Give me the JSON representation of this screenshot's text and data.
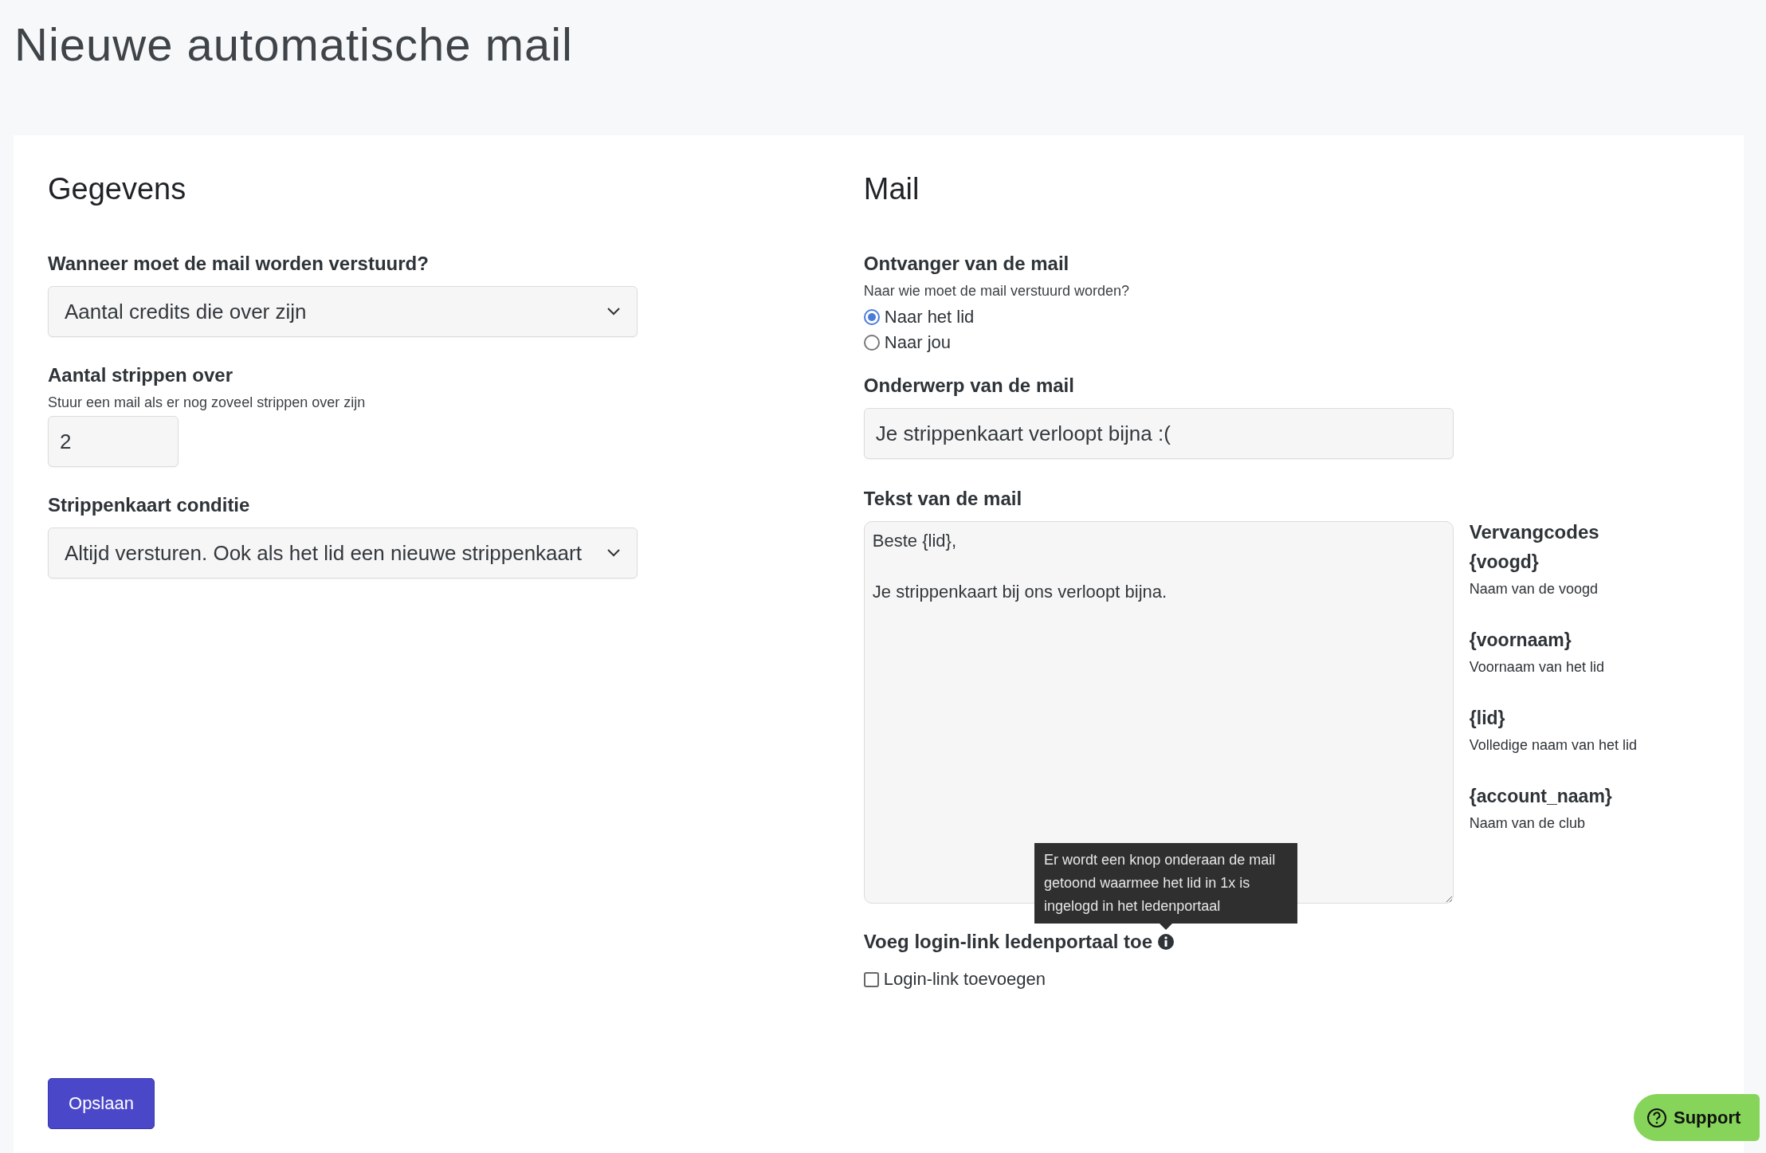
{
  "page_title": "Nieuwe automatische mail",
  "gegevens": {
    "heading": "Gegevens",
    "when": {
      "label": "Wanneer moet de mail worden verstuurd?",
      "value": "Aantal credits die over zijn"
    },
    "strips": {
      "label": "Aantal strippen over",
      "hint": "Stuur een mail als er nog zoveel strippen over zijn",
      "value": "2"
    },
    "condition": {
      "label": "Strippenkaart conditie",
      "value": "Altijd versturen. Ook als het lid een nieuwe strippenkaart"
    }
  },
  "mail": {
    "heading": "Mail",
    "recipient": {
      "label": "Ontvanger van de mail",
      "hint": "Naar wie moet de mail verstuurd worden?",
      "options": [
        {
          "label": "Naar het lid",
          "selected": true
        },
        {
          "label": "Naar jou",
          "selected": false
        }
      ]
    },
    "subject": {
      "label": "Onderwerp van de mail",
      "value": "Je strippenkaart verloopt bijna :("
    },
    "body": {
      "label": "Tekst van de mail",
      "value": "Beste {lid},\n\nJe strippenkaart bij ons verloopt bijna."
    },
    "codes": {
      "heading": "Vervangcodes",
      "items": [
        {
          "code": "{voogd}",
          "description": "Naam van de voogd"
        },
        {
          "code": "{voornaam}",
          "description": "Voornaam van het lid"
        },
        {
          "code": "{lid}",
          "description": "Volledige naam van het lid"
        },
        {
          "code": "{account_naam}",
          "description": "Naam van de club"
        }
      ]
    },
    "login_link": {
      "label": "Voeg login-link ledenportaal toe",
      "tooltip": "Er wordt een knop onderaan de mail getoond waarmee het lid in 1x is ingelogd in het ledenportaal",
      "checkbox_label": "Login-link toevoegen",
      "checked": false
    }
  },
  "save_button": "Opslaan",
  "support_button": "Support"
}
